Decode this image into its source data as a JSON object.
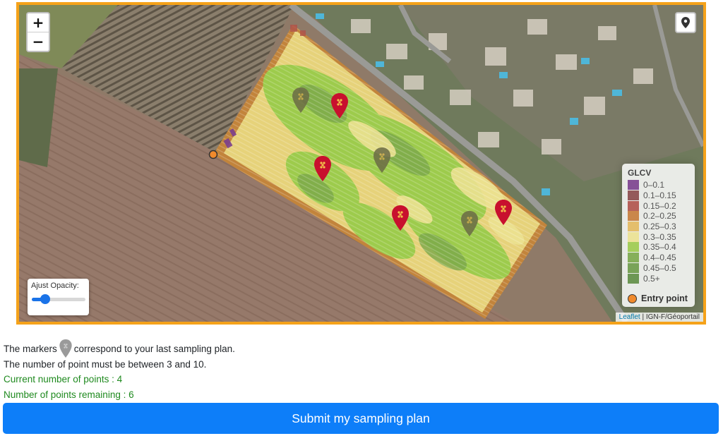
{
  "map": {
    "zoom_in_label": "+",
    "zoom_out_label": "−",
    "locate_icon": "map-pin-icon",
    "attribution_link": "Leaflet",
    "attribution_text": "| IGN-F/Géoportail",
    "opacity_label": "Ajust Opacity:",
    "opacity_value": 0.25,
    "legend": {
      "title": "GLCV",
      "items": [
        {
          "label": "0–0.1",
          "color": "#7b3f8e"
        },
        {
          "label": "0.1–0.15",
          "color": "#8b4a4a"
        },
        {
          "label": "0.15–0.2",
          "color": "#b0524a"
        },
        {
          "label": "0.2–0.25",
          "color": "#c77c3a"
        },
        {
          "label": "0.25–0.3",
          "color": "#e3b95e"
        },
        {
          "label": "0.3–0.35",
          "color": "#ece291"
        },
        {
          "label": "0.35–0.4",
          "color": "#9dcb4c"
        },
        {
          "label": "0.4–0.45",
          "color": "#7ba84a"
        },
        {
          "label": "0.45–0.5",
          "color": "#6d9b48"
        },
        {
          "label": "0.5+",
          "color": "#5f8e44"
        }
      ],
      "entry_label": "Entry point"
    },
    "markers": [
      {
        "type": "current",
        "color": "#c8102e"
      },
      {
        "type": "current",
        "color": "#c8102e"
      },
      {
        "type": "current",
        "color": "#c8102e"
      },
      {
        "type": "current",
        "color": "#c8102e"
      },
      {
        "type": "previous",
        "color": "#6b6b45"
      },
      {
        "type": "previous",
        "color": "#6b6b45"
      },
      {
        "type": "previous",
        "color": "#6b6b45"
      }
    ]
  },
  "info": {
    "markers_before": "The markers",
    "markers_after": "correspond to your last sampling plan.",
    "range_text": "The number of point must be between 3 and 10.",
    "current_points": "Current number of points : 4",
    "remaining_points": "Number of points remaining : 6"
  },
  "submit_label": "Submit my sampling plan"
}
